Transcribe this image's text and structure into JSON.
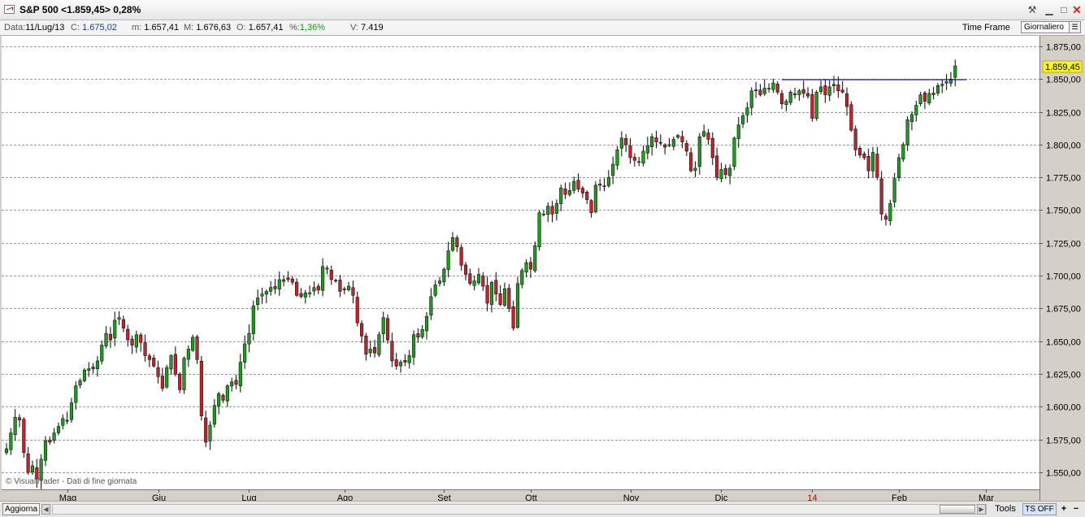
{
  "window": {
    "title": "S&P 500 <1.859,45> 0,28%"
  },
  "infobar": {
    "date_label": "Data:",
    "date": "11/Lug/13",
    "close_label": "C:",
    "close": "1.675,02",
    "min_label": "m:",
    "min": "1.657,41",
    "max_label": "M:",
    "max": "1.676,63",
    "open_label": "O:",
    "open": "1.657,41",
    "pct_label": "%:",
    "pct": "1,36%",
    "vol_label": "V:",
    "vol": "7.419",
    "timeframe_label": "Time Frame",
    "timeframe_value": "Giornaliero"
  },
  "watermark": "© VisualTrader - Dati di fine giornata",
  "statusbar": {
    "refresh": "Aggiorna",
    "tools": "Tools",
    "ts": "TS OFF",
    "plus": "+",
    "minus": "−"
  },
  "colors": {
    "up": "#1e9a1e",
    "down": "#c0242c",
    "hline": "#1a1aa8",
    "last_price_bg": "#f5f529"
  },
  "chart_data": {
    "type": "candlestick",
    "title": "S&P 500",
    "y_ticks": [
      "1.550,00",
      "1.575,00",
      "1.600,00",
      "1.625,00",
      "1.650,00",
      "1.675,00",
      "1.700,00",
      "1.725,00",
      "1.750,00",
      "1.775,00",
      "1.800,00",
      "1.825,00",
      "1.850,00",
      "1.875,00"
    ],
    "y_tick_values": [
      1550,
      1575,
      1600,
      1625,
      1650,
      1675,
      1700,
      1725,
      1750,
      1775,
      1800,
      1825,
      1850,
      1875
    ],
    "ylim": [
      1537,
      1883
    ],
    "x_ticks": [
      "Mag",
      "Giu",
      "Lug",
      "Ago",
      "Set",
      "Ott",
      "Nov",
      "Dic",
      "14",
      "Feb",
      "Mar"
    ],
    "x_tick_index": [
      14,
      35,
      56,
      78,
      101,
      121,
      144,
      165,
      186,
      206,
      226
    ],
    "x_tick_highlight": "14",
    "last_price": "1.859,45",
    "last_price_value": 1859.45,
    "resistance_level": 1849.5,
    "resistance_from_index": 179,
    "grid": "horizontal-dashed",
    "closes": [
      1568,
      1580,
      1592,
      1590,
      1565,
      1550,
      1555,
      1545,
      1560,
      1574,
      1573,
      1580,
      1585,
      1591,
      1589,
      1603,
      1616,
      1620,
      1628,
      1629,
      1629,
      1635,
      1647,
      1656,
      1651,
      1666,
      1668,
      1660,
      1651,
      1647,
      1655,
      1649,
      1639,
      1636,
      1631,
      1623,
      1614,
      1630,
      1639,
      1625,
      1613,
      1637,
      1644,
      1653,
      1636,
      1593,
      1573,
      1586,
      1601,
      1610,
      1605,
      1616,
      1619,
      1617,
      1634,
      1648,
      1656,
      1677,
      1683,
      1686,
      1688,
      1691,
      1690,
      1697,
      1697,
      1697,
      1695,
      1685,
      1684,
      1687,
      1687,
      1691,
      1689,
      1707,
      1705,
      1697,
      1696,
      1688,
      1690,
      1692,
      1685,
      1664,
      1654,
      1640,
      1644,
      1641,
      1655,
      1668,
      1651,
      1635,
      1631,
      1634,
      1634,
      1639,
      1655,
      1653,
      1659,
      1669,
      1684,
      1693,
      1696,
      1705,
      1719,
      1729,
      1722,
      1708,
      1701,
      1694,
      1696,
      1701,
      1692,
      1679,
      1695,
      1686,
      1678,
      1690,
      1675,
      1660,
      1694,
      1704,
      1710,
      1705,
      1723,
      1748,
      1747,
      1753,
      1747,
      1755,
      1767,
      1762,
      1765,
      1772,
      1766,
      1763,
      1758,
      1748,
      1769,
      1770,
      1768,
      1775,
      1785,
      1796,
      1805,
      1800,
      1790,
      1788,
      1787,
      1795,
      1799,
      1806,
      1802,
      1801,
      1798,
      1800,
      1804,
      1807,
      1802,
      1795,
      1780,
      1782,
      1806,
      1810,
      1804,
      1790,
      1775,
      1781,
      1777,
      1782,
      1805,
      1815,
      1822,
      1828,
      1841,
      1841,
      1838,
      1843,
      1843,
      1847,
      1840,
      1831,
      1833,
      1840,
      1838,
      1841,
      1839,
      1837,
      1820,
      1840,
      1844,
      1838,
      1844,
      1846,
      1841,
      1840,
      1829,
      1811,
      1796,
      1792,
      1790,
      1780,
      1794,
      1775,
      1747,
      1743,
      1755,
      1774,
      1790,
      1800,
      1819,
      1823,
      1830,
      1838,
      1833,
      1839,
      1838,
      1845,
      1846,
      1848,
      1850,
      1860
    ]
  }
}
